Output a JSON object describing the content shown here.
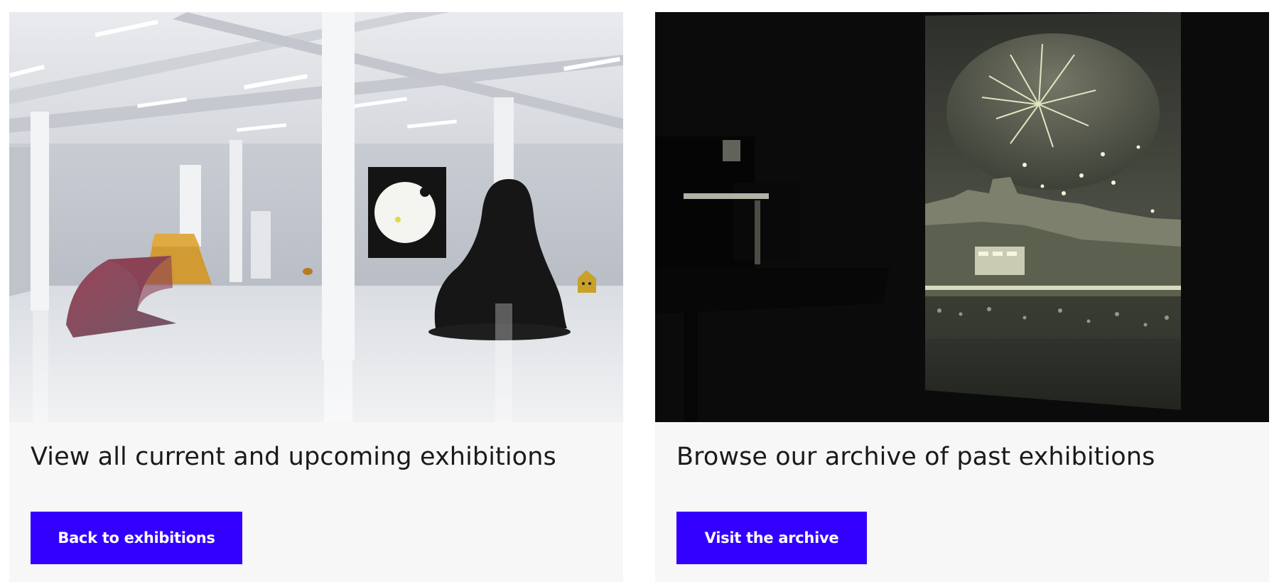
{
  "cards": [
    {
      "title": "View all current and upcoming exhibitions",
      "button_label": "Back to exhibitions",
      "image_alt": "Gallery installation view with sculptures"
    },
    {
      "title": "Browse our archive of past exhibitions",
      "button_label": "Visit the archive",
      "image_alt": "Projected photograph of fireworks over a castle"
    }
  ],
  "colors": {
    "button_bg": "#3300ff",
    "button_text": "#ffffff",
    "card_bg": "#f7f7f7",
    "title_text": "#1a1a1a"
  }
}
